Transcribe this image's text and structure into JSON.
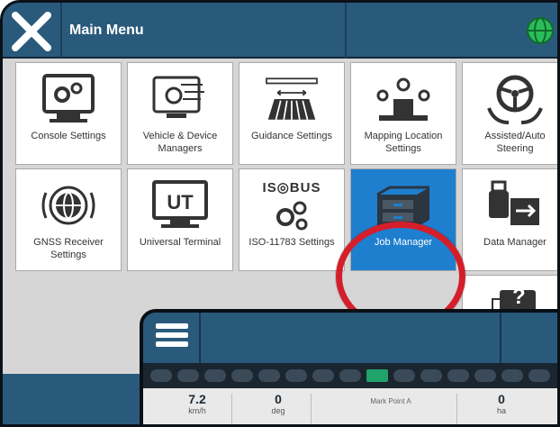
{
  "header": {
    "title": "Main Menu"
  },
  "tiles": [
    {
      "label": "Console Settings",
      "icon": "console-settings-icon"
    },
    {
      "label": "Vehicle & Device Managers",
      "icon": "vehicle-device-icon"
    },
    {
      "label": "Guidance Settings",
      "icon": "guidance-icon"
    },
    {
      "label": "Mapping Location Settings",
      "icon": "mapping-location-icon"
    },
    {
      "label": "Assisted/Auto Steering",
      "icon": "steering-wheel-icon"
    },
    {
      "label": "GNSS Receiver Settings",
      "icon": "gnss-globe-icon"
    },
    {
      "label": "Universal Terminal",
      "icon": "ut-monitor-icon"
    },
    {
      "label": "ISO-11783 Settings",
      "icon": "isobus-icon",
      "badge": "IS◎BUS"
    },
    {
      "label": "Job Manager",
      "icon": "job-manager-icon",
      "active": true
    },
    {
      "label": "Data Manager",
      "icon": "usb-transfer-icon"
    }
  ],
  "ut_badge": "UT",
  "help_badge": "?",
  "inset": {
    "readouts": [
      {
        "value": "7.2",
        "unit": "km/h"
      },
      {
        "value": "0",
        "unit": "deg"
      },
      {
        "value": "",
        "unit": "Mark Point A"
      },
      {
        "value": "0",
        "unit": "ha"
      }
    ]
  },
  "colors": {
    "accent": "#1e7fcf",
    "header": "#2a5a7b",
    "highlight": "#d41f2b"
  }
}
